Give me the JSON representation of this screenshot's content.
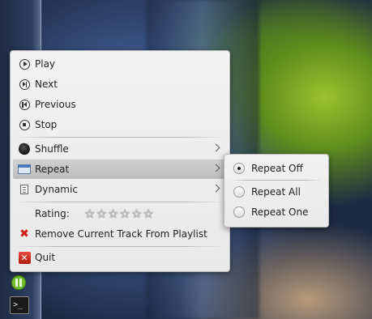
{
  "main_menu": {
    "items": [
      {
        "label": "Play"
      },
      {
        "label": "Next"
      },
      {
        "label": "Previous"
      },
      {
        "label": "Stop"
      },
      {
        "label": "Shuffle"
      },
      {
        "label": "Repeat"
      },
      {
        "label": "Dynamic"
      },
      {
        "label": "Remove Current Track From Playlist"
      },
      {
        "label": "Quit"
      }
    ],
    "rating_label": "Rating:",
    "rating_value": 0,
    "rating_max": 6
  },
  "repeat_submenu": {
    "items": [
      {
        "label": "Repeat Off",
        "checked": true
      },
      {
        "label": "Repeat All",
        "checked": false
      },
      {
        "label": "Repeat One",
        "checked": false
      }
    ]
  },
  "icons": {
    "play": "play-circle-icon",
    "next": "next-circle-icon",
    "previous": "previous-circle-icon",
    "stop": "stop-circle-icon",
    "shuffle": "shuffle-die-icon",
    "repeat": "repeat-window-icon",
    "dynamic": "dynamic-playlist-icon",
    "remove": "red-x-icon",
    "quit": "quit-icon",
    "tray_player": "pause-tray-icon",
    "tray_terminal": "terminal-icon"
  },
  "colors": {
    "menu_bg": "#eeeeee",
    "highlight": "#c6c6c6",
    "remove_icon": "#d01a1a",
    "tray_player": "#6fbf2a"
  }
}
